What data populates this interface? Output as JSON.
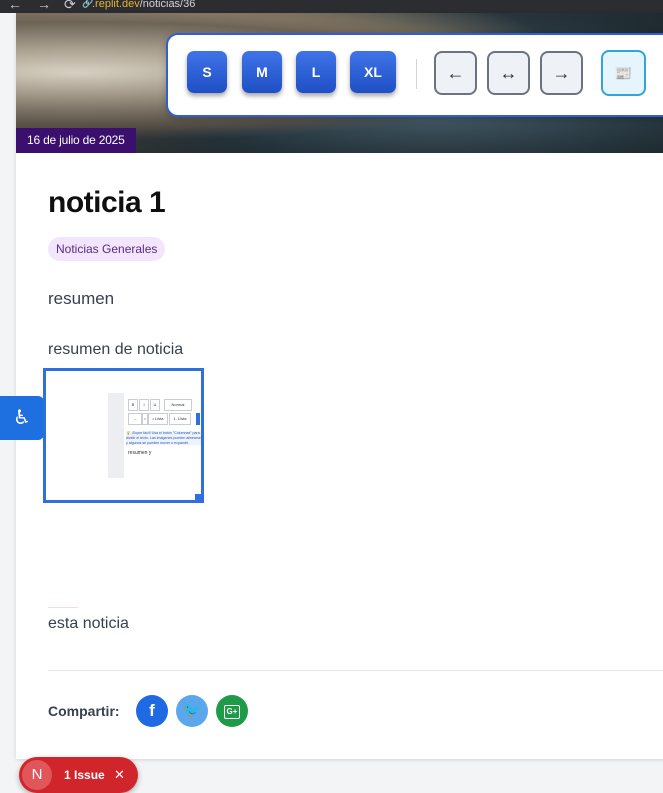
{
  "browser": {
    "url_domain": ".replit.dev",
    "url_path": "/noticias/36",
    "back_icon": "←",
    "forward_icon": "→",
    "reload_icon": "⟳",
    "lock_icon": "🔗"
  },
  "article": {
    "date": "16 de julio de 2025",
    "title": "noticia 1",
    "category": "Noticias Generales",
    "paragraphs": [
      "resumen",
      "resumen de noticia",
      "esta noticia"
    ]
  },
  "toolbar": {
    "font_sizes": [
      "S",
      "M",
      "L",
      "XL"
    ],
    "align": [
      "←",
      "↔",
      "→"
    ],
    "news_icon": "📰"
  },
  "editor_preview": {
    "format_buttons": [
      "B",
      "I",
      "U",
      "Normal"
    ],
    "list_buttons": [
      "→",
      "•",
      "• Lista",
      "1. Lista"
    ],
    "tip": "💡 ¡Super fácil! Usa el botón \"Columnas\" para dividir el texto. Las imágenes pueden alinearse y algunos se pueden mover o expandir.",
    "content": "resumen y"
  },
  "share": {
    "label": "Compartir:",
    "facebook": "f",
    "twitter": "🐦",
    "google": "G+"
  },
  "accessibility": {
    "icon": "♿"
  },
  "issues": {
    "avatar": "N",
    "label": "1 Issue",
    "close": "✕"
  }
}
